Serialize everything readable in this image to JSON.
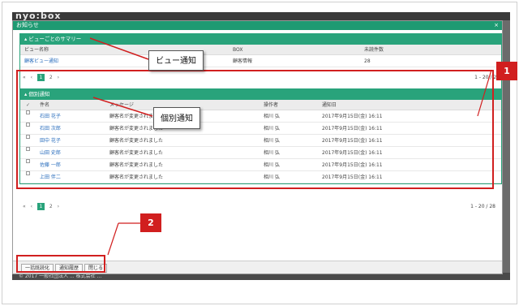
{
  "background": {
    "logo": "nyo:box",
    "footer_text": "© 2017 一般社団法人 ... 株式会社 ..."
  },
  "modal": {
    "title": "お知らせ",
    "close": "×"
  },
  "view_summary": {
    "title": "ビューごとのサマリー",
    "columns": [
      "ビュー名称",
      "BOX",
      "未読件数"
    ],
    "rows": [
      {
        "name": "顧客ビュー通知",
        "box": "顧客情報",
        "unread": "28"
      }
    ],
    "pager": {
      "first": "«",
      "prev": "‹",
      "current": "1",
      "page2": "2",
      "next": "›"
    },
    "range": "1 - 20 / 28"
  },
  "individual": {
    "title": "個別通知",
    "columns": [
      "件名",
      "メッセージ",
      "操作者",
      "通知日"
    ],
    "rows": [
      {
        "name": "石田 花子",
        "message": "顧客名が変更されました",
        "operator": "相川 弘",
        "date": "2017年9月15日(金) 16:11"
      },
      {
        "name": "石田 次郎",
        "message": "顧客名が変更されました",
        "operator": "相川 弘",
        "date": "2017年9月15日(金) 16:11"
      },
      {
        "name": "田中 花子",
        "message": "顧客名が変更されました",
        "operator": "相川 弘",
        "date": "2017年9月15日(金) 16:11"
      },
      {
        "name": "山田 史郎",
        "message": "顧客名が変更されました",
        "operator": "相川 弘",
        "date": "2017年9月15日(金) 16:11"
      },
      {
        "name": "佐藤 一郎",
        "message": "顧客名が変更されました",
        "operator": "相川 弘",
        "date": "2017年9月15日(金) 16:11"
      },
      {
        "name": "上田 伴二",
        "message": "顧客名が変更されました",
        "operator": "相川 弘",
        "date": "2017年9月15日(金) 16:11"
      }
    ],
    "pager": {
      "first": "«",
      "prev": "‹",
      "current": "1",
      "page2": "2",
      "next": "›"
    },
    "range": "1 - 20 / 28"
  },
  "footer_buttons": {
    "mark_all_read": "一括既読化",
    "history": "通知履歴",
    "close": "閉じる"
  },
  "annotations": {
    "callout1": "ビュー通知",
    "callout2": "個別通知",
    "badge1": "1",
    "badge2": "2"
  },
  "colors": {
    "accent": "#29a37b",
    "annotation": "#d11f1f"
  }
}
